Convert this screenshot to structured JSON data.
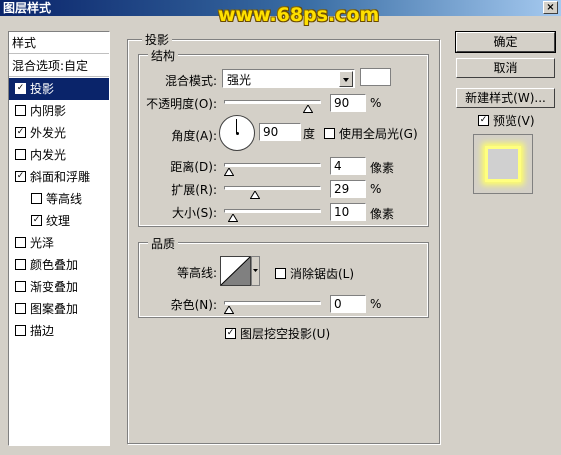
{
  "window": {
    "title": "图层样式",
    "watermark": "www.68ps.com",
    "close_glyph": "×"
  },
  "styles_panel": {
    "header": "样式",
    "blend_options": "混合选项:自定",
    "items": [
      {
        "label": "投影",
        "checked": true,
        "selected": true,
        "indent": false
      },
      {
        "label": "内阴影",
        "checked": false,
        "selected": false,
        "indent": false
      },
      {
        "label": "外发光",
        "checked": true,
        "selected": false,
        "indent": false
      },
      {
        "label": "内发光",
        "checked": false,
        "selected": false,
        "indent": false
      },
      {
        "label": "斜面和浮雕",
        "checked": true,
        "selected": false,
        "indent": false
      },
      {
        "label": "等高线",
        "checked": false,
        "selected": false,
        "indent": true
      },
      {
        "label": "纹理",
        "checked": true,
        "selected": false,
        "indent": true
      },
      {
        "label": "光泽",
        "checked": false,
        "selected": false,
        "indent": false
      },
      {
        "label": "颜色叠加",
        "checked": false,
        "selected": false,
        "indent": false
      },
      {
        "label": "渐变叠加",
        "checked": false,
        "selected": false,
        "indent": false
      },
      {
        "label": "图案叠加",
        "checked": false,
        "selected": false,
        "indent": false
      },
      {
        "label": "描边",
        "checked": false,
        "selected": false,
        "indent": false
      }
    ]
  },
  "drop_shadow": {
    "section_title": "投影",
    "structure": {
      "group_title": "结构",
      "blend_mode_label": "混合模式:",
      "blend_mode_value": "强光",
      "shadow_color": "#ffffff",
      "opacity_label": "不透明度(O):",
      "opacity_value": "90",
      "opacity_unit": "%",
      "opacity_level": 0.9,
      "angle_label": "角度(A):",
      "angle_value": "90",
      "angle_unit": "度",
      "global_light_label": "使用全局光(G)",
      "global_light_checked": false,
      "distance_label": "距离(D):",
      "distance_value": "4",
      "distance_unit": "像素",
      "distance_level": 0.0,
      "spread_label": "扩展(R):",
      "spread_value": "29",
      "spread_unit": "%",
      "spread_level": 0.29,
      "size_label": "大小(S):",
      "size_value": "10",
      "size_unit": "像素",
      "size_level": 0.04
    },
    "quality": {
      "group_title": "品质",
      "contour_label": "等高线:",
      "anti_alias_label": "消除锯齿(L)",
      "anti_alias_checked": false,
      "noise_label": "杂色(N):",
      "noise_value": "0",
      "noise_unit": "%",
      "noise_level": 0.0
    },
    "knockout_label": "图层挖空投影(U)",
    "knockout_checked": true
  },
  "buttons": {
    "ok": "确定",
    "cancel": "取消",
    "new_style": "新建样式(W)...",
    "preview_label": "预览(V)",
    "preview_checked": true
  },
  "colors": {
    "selection": "#0a246a",
    "preview_glow": "#ffff66"
  }
}
